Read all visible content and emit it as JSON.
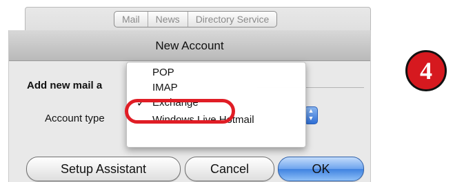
{
  "background_window": {
    "tabs": [
      {
        "label": "Mail"
      },
      {
        "label": "News"
      },
      {
        "label": "Directory Service"
      }
    ]
  },
  "sheet": {
    "title": "New Account",
    "add_label": "Add new mail a",
    "account_type_label": "Account type",
    "buttons": {
      "setup": "Setup Assistant",
      "cancel": "Cancel",
      "ok": "OK"
    }
  },
  "dropdown": {
    "items": [
      {
        "label": "POP"
      },
      {
        "label": "IMAP"
      },
      {
        "label": "Exchange"
      },
      {
        "label": "Windows Live Hotmail"
      }
    ],
    "selected": "Exchange",
    "check_glyph": "✓",
    "highlight_color": "#e01d25"
  },
  "step_marker": {
    "number": "4",
    "color": "#d6191f"
  }
}
